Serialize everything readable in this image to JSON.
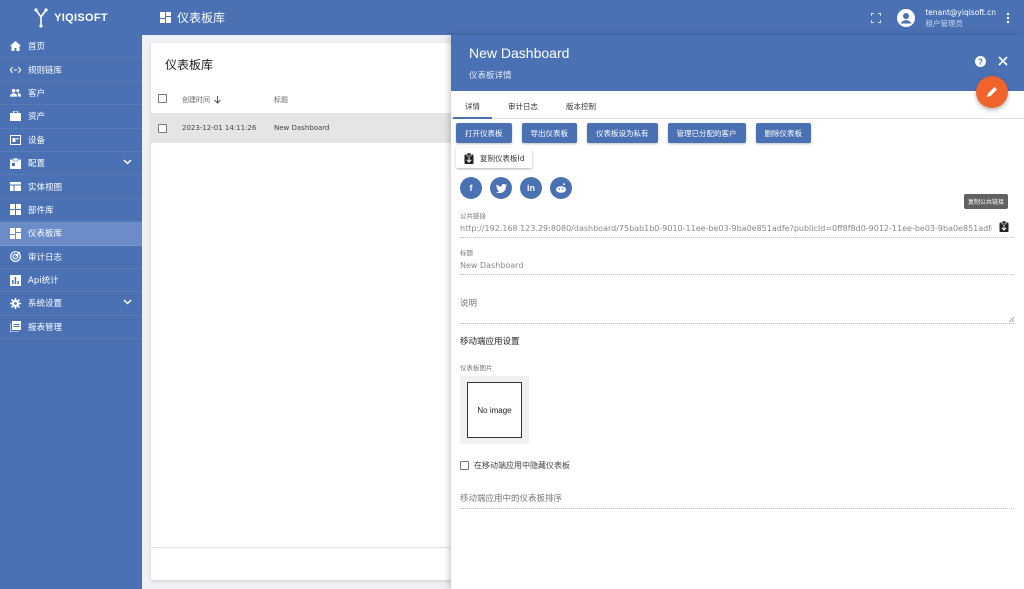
{
  "topbar": {
    "brand": "YIQISOFT",
    "page_title": "仪表板库",
    "user_email": "tenant@yiqisoft.cn",
    "user_role": "租户管理员"
  },
  "sidebar": {
    "items": [
      {
        "label": "首页",
        "icon": "home-icon"
      },
      {
        "label": "规则链库",
        "icon": "rule-chain-icon"
      },
      {
        "label": "客户",
        "icon": "customers-icon"
      },
      {
        "label": "资产",
        "icon": "assets-icon"
      },
      {
        "label": "设备",
        "icon": "devices-icon"
      },
      {
        "label": "配置",
        "icon": "profiles-icon",
        "expandable": true
      },
      {
        "label": "实体视图",
        "icon": "entity-view-icon"
      },
      {
        "label": "部件库",
        "icon": "widgets-icon"
      },
      {
        "label": "仪表板库",
        "icon": "dashboards-icon",
        "active": true
      },
      {
        "label": "审计日志",
        "icon": "audit-log-icon"
      },
      {
        "label": "Api统计",
        "icon": "api-usage-icon"
      },
      {
        "label": "系统设置",
        "icon": "settings-icon",
        "expandable": true
      },
      {
        "label": "报表管理",
        "icon": "reports-icon"
      }
    ]
  },
  "list": {
    "title": "仪表板库",
    "columns": {
      "created": "创建时间",
      "title": "标题"
    },
    "rows": [
      {
        "created": "2023-12-01 14:11:26",
        "title": "New Dashboard"
      }
    ]
  },
  "detail": {
    "title": "New Dashboard",
    "subtitle": "仪表板详情",
    "tabs": [
      "详情",
      "审计日志",
      "版本控制"
    ],
    "actions": [
      "打开仪表板",
      "导出仪表板",
      "仪表板设为私有",
      "管理已分配的客户",
      "删除仪表板"
    ],
    "copy_id": "复制仪表板Id",
    "tooltip": "复制公共链接",
    "public_link_label": "公共链接",
    "public_link": "http://192.168.123.29:8080/dashboard/75bab1b0-9010-11ee-be03-9ba0e851adfe?publicId=0ff8f8d0-9012-11ee-be03-9ba0e851adfe",
    "title_label": "标题",
    "title_value": "New Dashboard",
    "description_label": "说明",
    "mobile_section": "移动端应用设置",
    "image_label": "仪表板图片",
    "no_image": "No image",
    "hide_mobile": "在移动端应用中隐藏仪表板",
    "mobile_order_label": "移动端应用中的仪表板排序"
  },
  "colors": {
    "primary": "#4a71b4",
    "active": "#6b8cc8",
    "fab": "#f0642c"
  }
}
